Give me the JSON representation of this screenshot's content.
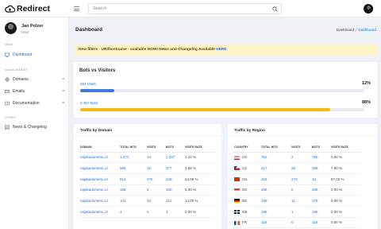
{
  "app": {
    "name": "Redirect"
  },
  "search": {
    "placeholder": "Search"
  },
  "user": {
    "name": "Jan Polzer",
    "role": "User"
  },
  "sidebar": {
    "sections": [
      "MAIN",
      "MANAGEMENT",
      "OTHER"
    ],
    "items": [
      {
        "label": "Dashboard",
        "icon": "monitor-icon",
        "active": true
      },
      {
        "label": "Domains",
        "icon": "globe-icon",
        "has_submenu": true
      },
      {
        "label": "Emails",
        "icon": "mail-icon",
        "has_submenu": true
      },
      {
        "label": "Documentation",
        "icon": "book-icon",
        "has_submenu": true
      },
      {
        "label": "News & Changelog",
        "icon": "newspaper-icon"
      }
    ]
  },
  "page": {
    "title": "Dashboard"
  },
  "breadcrumb": {
    "items": [
      "Dashboard",
      "Dashboard"
    ],
    "separator": "/"
  },
  "alert": {
    "text": "New filters - URI/hostname - available NOW! News and Changelog Available ",
    "link": "HERE"
  },
  "bots_vs_visitors": {
    "title": "Bots vs Visitors",
    "visits_label": "334 Visits",
    "visits_pct_label": "12%",
    "visits_fraction": 0.12,
    "bots_label": "2 357 Bots",
    "bots_pct_label": "88%",
    "bots_fraction": 0.88
  },
  "traffic_by_domain": {
    "title": "Traffic by Domain",
    "columns": [
      "DOMAIN",
      "TOTAL HITS",
      "VISITS",
      "BOTS",
      "VISITS RATE"
    ],
    "rows": [
      [
        "najakadomenu.cz",
        "1 271",
        "14",
        "1 257",
        "1,10 %"
      ],
      [
        "najakadomenu.cz",
        "593",
        "16",
        "377",
        "3,06 %"
      ],
      [
        "najakadomenu.cz",
        "514",
        "276",
        "238",
        "54,09 %"
      ],
      [
        "najakadomenu.cz",
        "168",
        "8",
        "160",
        "5,00 %"
      ],
      [
        "najakadomenu.cz",
        "141",
        "20",
        "121",
        "14,00 %"
      ],
      [
        "najakadomenu.cz",
        "4",
        "0",
        "4",
        "0,00 %"
      ]
    ]
  },
  "traffic_by_region": {
    "title": "Traffic by Region",
    "columns": [
      "COUNTRY",
      "TOTAL HITS",
      "VISITS",
      "BOTS",
      "VISITS RATE"
    ],
    "rows": [
      {
        "code": "US",
        "flag": "us",
        "hits": "762",
        "visits": "2",
        "bots": "760",
        "rate": "0,00 %"
      },
      {
        "code": "CZ",
        "flag": "cz",
        "hits": "417",
        "visits": "28",
        "bots": "389",
        "rate": "7,90 %"
      },
      {
        "code": "CN",
        "flag": "cn",
        "hits": "315",
        "visits": "273",
        "bots": "42",
        "rate": "87,00 %"
      },
      {
        "code": "SG",
        "flag": "sg",
        "hits": "286",
        "visits": "0",
        "bots": "286",
        "rate": "0,00 %"
      },
      {
        "code": "DE",
        "flag": "de",
        "hits": "189",
        "visits": "11",
        "bots": "178",
        "rate": "6,00 %"
      },
      {
        "code": "GB",
        "flag": "gb",
        "hits": "186",
        "visits": "1",
        "bots": "185",
        "rate": "0,00 %"
      },
      {
        "code": "FR",
        "flag": "fr",
        "hits": "115",
        "visits": "0",
        "bots": "115",
        "rate": "0,00 %"
      }
    ]
  },
  "colors": {
    "accent": "#2c6fd6",
    "visits_bar": "#3d7be0",
    "bots_bar": "#f5b90f",
    "alert_bg": "#fdf2c6"
  }
}
